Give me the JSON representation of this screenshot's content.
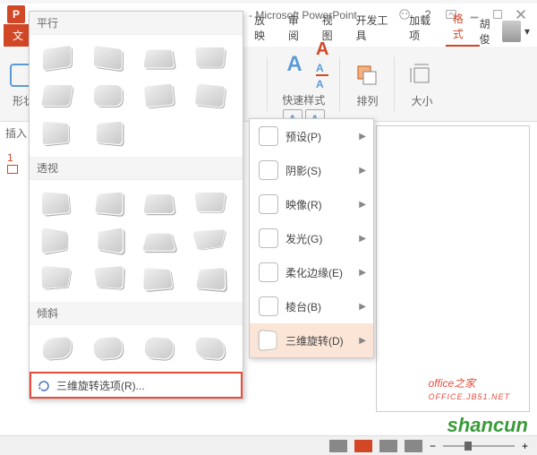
{
  "titlebar": {
    "app_title": "- Microsoft PowerPoint"
  },
  "tabs": {
    "file": "文",
    "list": [
      "放映",
      "审阅",
      "视图",
      "开发工具",
      "加载项",
      "格式"
    ],
    "user": "胡俊"
  },
  "ribbon": {
    "shape_label": "形状",
    "insert_label": "插入",
    "quickstyle_label": "快速样式",
    "arrange_label": "排列",
    "size_label": "大小"
  },
  "gallery": {
    "sect_parallel": "平行",
    "sect_perspective": "透视",
    "sect_oblique": "倾斜",
    "options": "三维旋转选项(R)..."
  },
  "sidemenu": {
    "items": [
      {
        "label": "预设(P)"
      },
      {
        "label": "阴影(S)"
      },
      {
        "label": "映像(R)"
      },
      {
        "label": "发光(G)"
      },
      {
        "label": "柔化边缘(E)"
      },
      {
        "label": "棱台(B)"
      },
      {
        "label": "三维旋转(D)"
      }
    ]
  },
  "left": {
    "slide_num": "1"
  },
  "watermark": {
    "office": "office",
    "zhijia": "之家",
    "url": "OFFICE.JB51.NET",
    "shancun": "shancun"
  }
}
